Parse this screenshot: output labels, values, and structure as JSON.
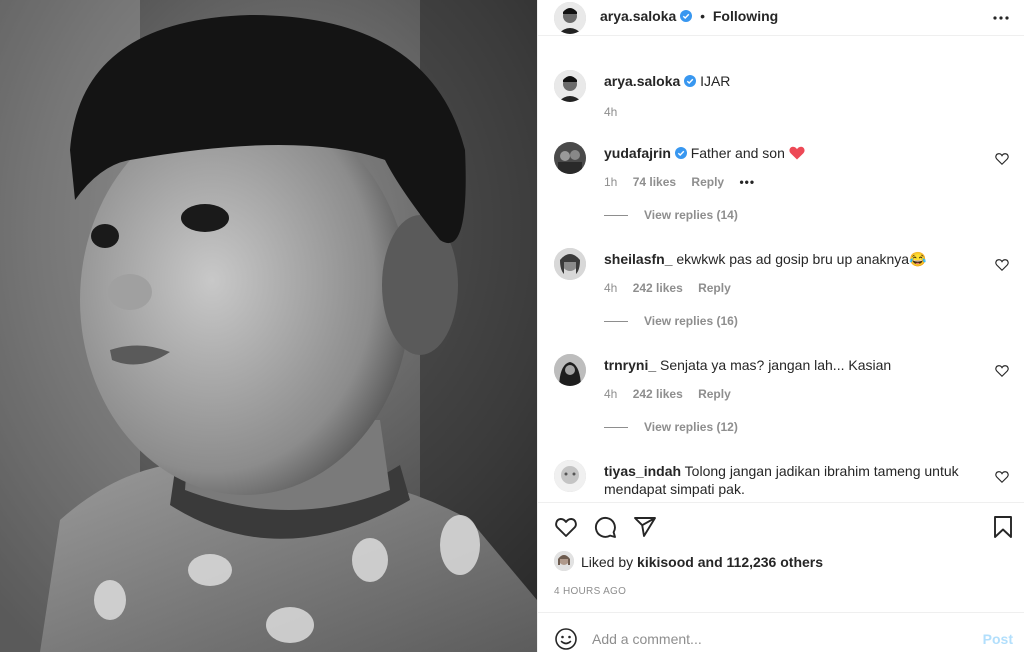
{
  "post": {
    "author": "arya.saloka",
    "follow_status": "Following",
    "caption": "IJAR",
    "caption_time": "4h"
  },
  "comments": [
    {
      "user": "yudafajrin",
      "verified": true,
      "text": "Father and son",
      "emoji": "red-heart",
      "time": "1h",
      "likes": "74 likes",
      "reply": "Reply",
      "more": "•••",
      "replies": "View replies (14)"
    },
    {
      "user": "sheilasfn_",
      "verified": false,
      "text": "ekwkwk pas ad gosip bru up anaknya😂",
      "time": "4h",
      "likes": "242 likes",
      "reply": "Reply",
      "replies": "View replies (16)"
    },
    {
      "user": "trnryni_",
      "verified": false,
      "text": "Senjata ya mas? jangan lah... Kasian",
      "time": "4h",
      "likes": "242 likes",
      "reply": "Reply",
      "replies": "View replies (12)"
    },
    {
      "user": "tiyas_indah",
      "verified": false,
      "text": "Tolong jangan jadikan ibrahim tameng untuk mendapat simpati pak."
    }
  ],
  "liked_by": {
    "prefix": "Liked by",
    "user": "kikisood",
    "suffix": "and 112,236 others"
  },
  "timestamp": "4 HOURS AGO",
  "comment_box": {
    "placeholder": "Add a comment...",
    "post_label": "Post"
  },
  "colors": {
    "verified": "#3897f0",
    "post_disabled": "#b2dffc",
    "heart": "#ed4956"
  }
}
